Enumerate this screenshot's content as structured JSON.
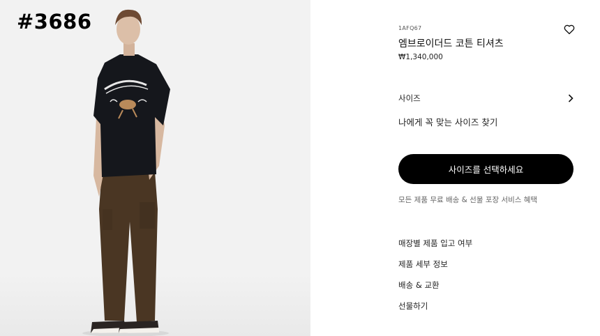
{
  "watermark": "#3686",
  "product": {
    "sku": "1AFQ67",
    "name": "엠브로이더드 코튼 티셔츠",
    "price": "₩1,340,000",
    "size_label": "사이즈",
    "size_finder": "나에게 꼭 맞는 사이즈 찾기",
    "cta_label": "사이즈를 선택하세요",
    "benefit": "모든 제품 무료 배송 & 선물 포장 서비스 혜택"
  },
  "links": [
    {
      "label": "매장별 제품 입고 여부"
    },
    {
      "label": "제품 세부 정보"
    },
    {
      "label": "배송 & 교환"
    },
    {
      "label": "선물하기"
    }
  ],
  "icons": {
    "wishlist": "heart-icon",
    "size_arrow": "chevron-right-icon"
  },
  "colors": {
    "cta_background": "#000000",
    "image_background": "#f2f2f2",
    "tshirt": "#15171c",
    "pants": "#4a3623"
  }
}
